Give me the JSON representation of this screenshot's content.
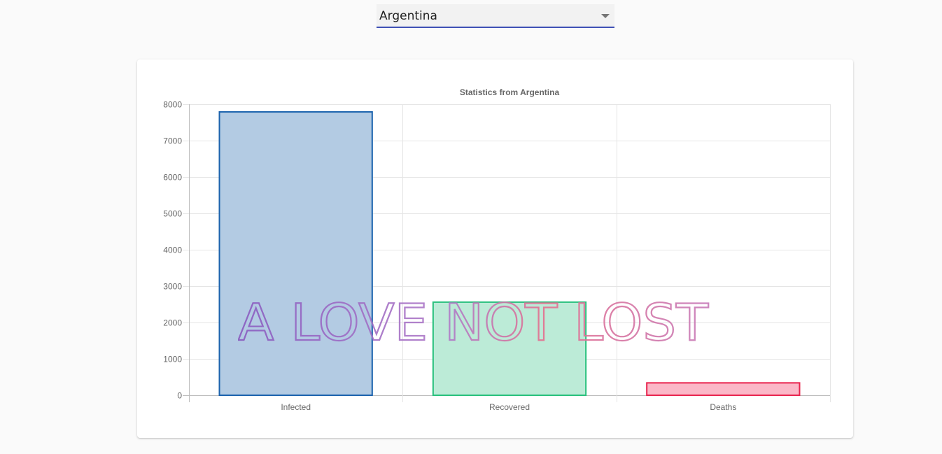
{
  "selector": {
    "value": "Argentina"
  },
  "watermark": {
    "text": "A LOVE NOT LOST"
  },
  "chart_data": {
    "type": "bar",
    "title": "Statistics from Argentina",
    "categories": [
      "Infected",
      "Recovered",
      "Deaths"
    ],
    "values": [
      7790,
      2560,
      340
    ],
    "ylim": [
      0,
      8000
    ],
    "yticks": [
      0,
      1000,
      2000,
      3000,
      4000,
      5000,
      6000,
      7000,
      8000
    ],
    "grid": true,
    "legend": "none",
    "colors": {
      "Infected": {
        "fill": "#b3cbe3",
        "stroke": "#1b62ad"
      },
      "Recovered": {
        "fill": "#bcebd7",
        "stroke": "#27c07c"
      },
      "Deaths": {
        "fill": "#fbb8c8",
        "stroke": "#e8254f"
      }
    }
  }
}
